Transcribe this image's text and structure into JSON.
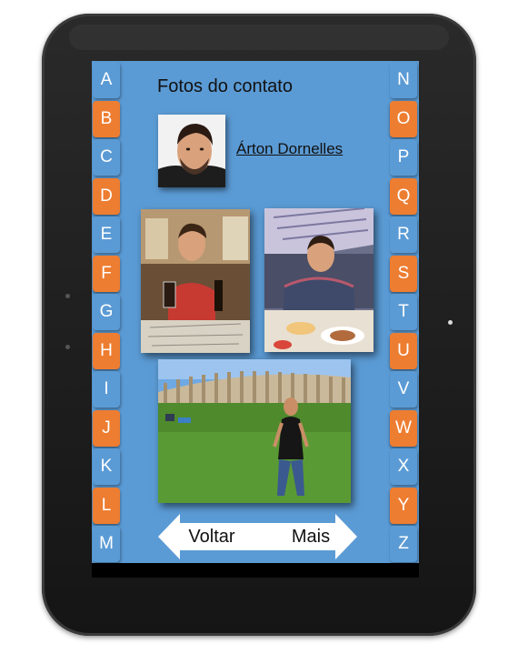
{
  "page": {
    "title": "Fotos do contato"
  },
  "contact": {
    "name": "Árton Dornelles"
  },
  "alphabet": {
    "left": [
      {
        "letter": "A",
        "color": "blue"
      },
      {
        "letter": "B",
        "color": "orange"
      },
      {
        "letter": "C",
        "color": "blue"
      },
      {
        "letter": "D",
        "color": "orange"
      },
      {
        "letter": "E",
        "color": "blue"
      },
      {
        "letter": "F",
        "color": "orange"
      },
      {
        "letter": "G",
        "color": "blue"
      },
      {
        "letter": "H",
        "color": "orange"
      },
      {
        "letter": "I",
        "color": "blue"
      },
      {
        "letter": "J",
        "color": "orange"
      },
      {
        "letter": "K",
        "color": "blue"
      },
      {
        "letter": "L",
        "color": "orange"
      },
      {
        "letter": "M",
        "color": "blue"
      }
    ],
    "right": [
      {
        "letter": "N",
        "color": "blue"
      },
      {
        "letter": "O",
        "color": "orange"
      },
      {
        "letter": "P",
        "color": "blue"
      },
      {
        "letter": "Q",
        "color": "orange"
      },
      {
        "letter": "R",
        "color": "blue"
      },
      {
        "letter": "S",
        "color": "orange"
      },
      {
        "letter": "T",
        "color": "blue"
      },
      {
        "letter": "U",
        "color": "orange"
      },
      {
        "letter": "V",
        "color": "blue"
      },
      {
        "letter": "W",
        "color": "orange"
      },
      {
        "letter": "X",
        "color": "blue"
      },
      {
        "letter": "Y",
        "color": "orange"
      },
      {
        "letter": "Z",
        "color": "blue"
      }
    ]
  },
  "nav": {
    "back_label": "Voltar",
    "more_label": "Mais"
  },
  "colors": {
    "screen_blue": "#5b9bd5",
    "letter_orange": "#ed7d31",
    "button_white": "#ffffff"
  }
}
